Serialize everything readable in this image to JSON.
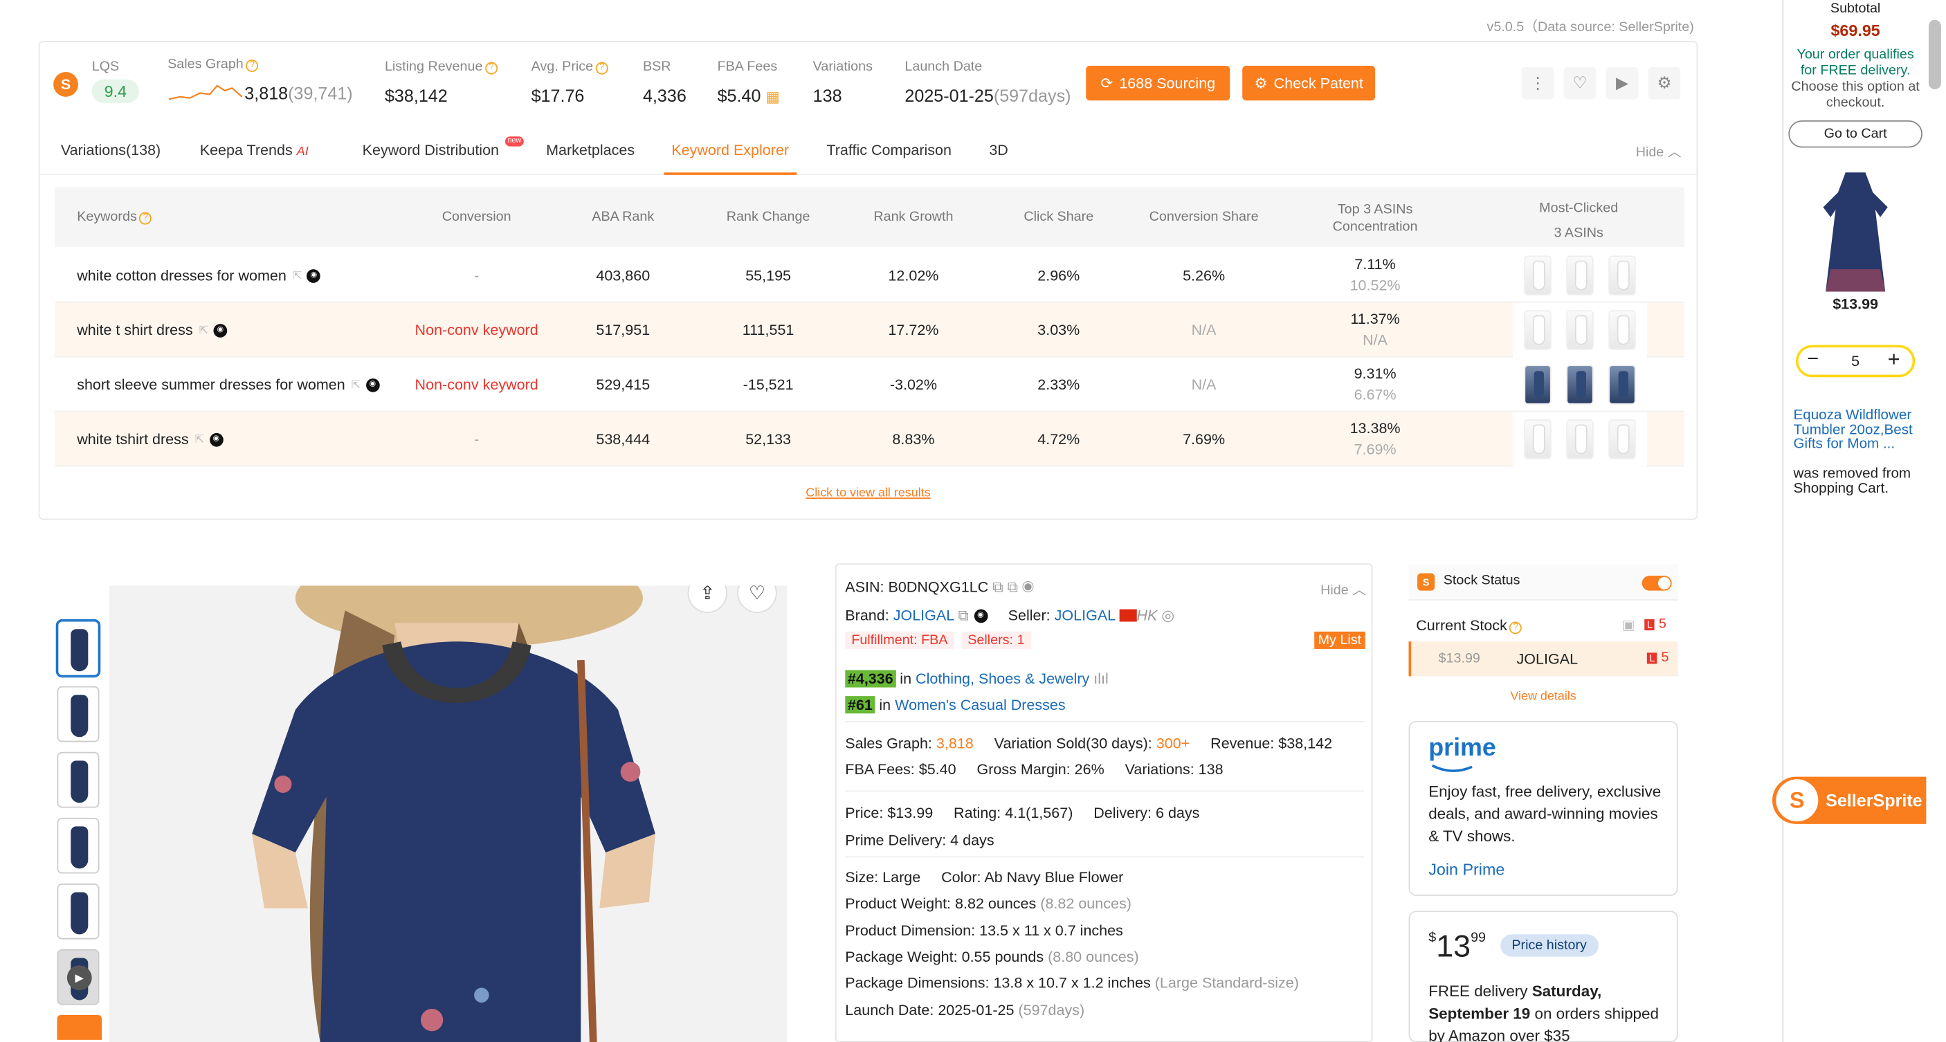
{
  "header": {
    "version": "v5.0.5（Data source: SellerSprite)",
    "lqs": {
      "label": "LQS",
      "value": "9.4"
    },
    "sales_graph": {
      "label": "Sales Graph",
      "value": "3,818",
      "sub": "(39,741)"
    },
    "listing_revenue": {
      "label": "Listing Revenue",
      "value": "$38,142"
    },
    "avg_price": {
      "label": "Avg. Price",
      "value": "$17.76"
    },
    "bsr": {
      "label": "BSR",
      "value": "4,336"
    },
    "fba_fees": {
      "label": "FBA Fees",
      "value": "$5.40"
    },
    "variations": {
      "label": "Variations",
      "value": "138"
    },
    "launch_date": {
      "label": "Launch Date",
      "value": "2025-01-25",
      "sub": "(597days)"
    },
    "sourcing_button": "1688 Sourcing",
    "patent_button": "Check Patent"
  },
  "tabs": {
    "variations": "Variations(138)",
    "keepa": "Keepa Trends",
    "keepa_ai": "AI",
    "keyword_distribution": "Keyword Distribution",
    "new_badge": "new",
    "marketplaces": "Marketplaces",
    "keyword_explorer": "Keyword Explorer",
    "traffic": "Traffic Comparison",
    "three_d": "3D",
    "hide": "Hide"
  },
  "table": {
    "headers": {
      "keywords": "Keywords",
      "conversion": "Conversion",
      "aba_rank": "ABA Rank",
      "rank_change": "Rank Change",
      "rank_growth": "Rank Growth",
      "click_share": "Click Share",
      "conversion_share": "Conversion Share",
      "top3_line1": "Top 3 ASINs",
      "top3_line2": "Concentration",
      "most_clicked_line1": "Most-Clicked",
      "most_clicked_line2": "3 ASINs"
    },
    "rows": [
      {
        "keyword": "white cotton dresses for women",
        "conversion": "-",
        "aba_rank": "403,860",
        "rank_change": "55,195",
        "rank_growth": "12.02%",
        "click_share": "2.96%",
        "conversion_share": "5.26%",
        "top3": "7.11%",
        "top3_sub": "10.52%"
      },
      {
        "keyword": "white t shirt dress",
        "conversion": "Non-conv keyword",
        "aba_rank": "517,951",
        "rank_change": "111,551",
        "rank_growth": "17.72%",
        "click_share": "3.03%",
        "conversion_share": "N/A",
        "top3": "11.37%",
        "top3_sub": "N/A"
      },
      {
        "keyword": "short sleeve summer dresses for women",
        "conversion": "Non-conv keyword",
        "aba_rank": "529,415",
        "rank_change": "-15,521",
        "rank_growth": "-3.02%",
        "click_share": "2.33%",
        "conversion_share": "N/A",
        "top3": "9.31%",
        "top3_sub": "6.67%"
      },
      {
        "keyword": "white tshirt dress",
        "conversion": "-",
        "aba_rank": "538,444",
        "rank_change": "52,133",
        "rank_growth": "8.83%",
        "click_share": "4.72%",
        "conversion_share": "7.69%",
        "top3": "13.38%",
        "top3_sub": "7.69%"
      }
    ],
    "view_all": "Click to view all results"
  },
  "product": {
    "asin_label": "ASIN:",
    "asin": "B0DNQXG1LC",
    "hide": "Hide",
    "brand_label": "Brand:",
    "brand": "JOLIGAL",
    "seller_label": "Seller:",
    "seller": "JOLIGAL",
    "seller_region": "HK",
    "fulfillment": "Fulfillment: FBA",
    "sellers": "Sellers: 1",
    "my_list": "My List",
    "rank1": "#4,336",
    "rank1_in": "in",
    "rank1_cat": "Clothing, Shoes & Jewelry",
    "rank2": "#61",
    "rank2_in": "in",
    "rank2_cat": "Women's Casual Dresses",
    "sales_graph_label": "Sales Graph:",
    "sales_graph": "3,818",
    "variation_sold_label": "Variation Sold(30 days):",
    "variation_sold": "300+",
    "revenue": "Revenue: $38,142",
    "fba_fees": "FBA Fees:  $5.40",
    "gross_margin": "Gross Margin: 26%",
    "variations": "Variations: 138",
    "price_label": "Price:",
    "price": "$13.99",
    "rating_label": "Rating:",
    "rating": "4.1(1,567)",
    "delivery_label": "Delivery:",
    "delivery": "6 days",
    "prime_delivery": "Prime Delivery: 4 days",
    "size_label": "Size:",
    "size": "Large",
    "color_label": "Color:",
    "color": "Ab Navy Blue Flower",
    "weight_label": "Product Weight:",
    "weight": "8.82 ounces",
    "weight_sub": "(8.82 ounces)",
    "dimension_label": "Product Dimension:",
    "dimension": "13.5 x 11 x 0.7 inches",
    "pkg_weight_label": "Package Weight:",
    "pkg_weight": "0.55 pounds",
    "pkg_weight_sub": "(8.80 ounces)",
    "pkg_dim_label": "Package Dimensions:",
    "pkg_dim": "13.8 x 10.7 x 1.2 inches",
    "pkg_dim_sub": "(Large Standard-size)",
    "launch_label": "Launch Date:",
    "launch": "2025-01-25",
    "launch_sub": "(597days)"
  },
  "stock": {
    "title": "Stock Status",
    "current": "Current Stock",
    "count": "5",
    "price": "$13.99",
    "seller": "JOLIGAL",
    "seller_count": "5",
    "view": "View details"
  },
  "prime": {
    "logo": "prime",
    "text": "Enjoy fast, free delivery, exclusive deals, and award-winning movies & TV shows.",
    "join": "Join Prime"
  },
  "buybox": {
    "price_symbol": "$",
    "price_whole": "13",
    "price_frac": "99",
    "price_history": "Price history",
    "delivery_prefix": "FREE delivery",
    "delivery_date": "Saturday, September 19",
    "delivery_suffix": "on orders shipped by Amazon over $35"
  },
  "cart": {
    "subtotal_label": "Subtotal",
    "subtotal": "$69.95",
    "qualifies": "Your order qualifies for FREE delivery.",
    "choose": "Choose this option at checkout.",
    "go_to_cart": "Go to Cart",
    "item_price": "$13.99",
    "qty": "5",
    "removed_link": "Equoza Wildflower Tumbler 20oz,Best Gifts for Mom ...",
    "removed_text": "was removed from Shopping Cart."
  },
  "sellersprite_badge": "SellerSprite",
  "colors": {
    "accent": "#fa7d1e",
    "link": "#1a6bb8",
    "rank_green": "#68b936",
    "price_red": "#b12704"
  }
}
